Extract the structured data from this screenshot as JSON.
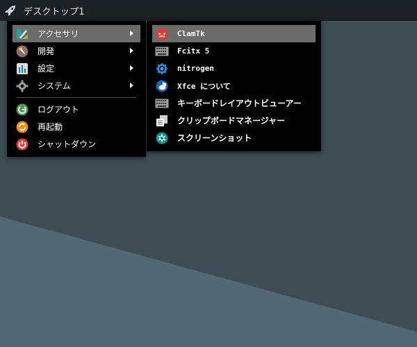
{
  "panel": {
    "title": "デスクトップ1",
    "launcher_icon": "rocket-icon"
  },
  "main_menu": {
    "items": [
      {
        "label": "アクセサリ",
        "icon": "accessories-icon",
        "submenu": true,
        "active": true
      },
      {
        "label": "開発",
        "icon": "development-icon",
        "submenu": true
      },
      {
        "label": "設定",
        "icon": "settings-icon",
        "submenu": true
      },
      {
        "label": "システム",
        "icon": "system-gear-icon",
        "submenu": true
      }
    ],
    "session_items": [
      {
        "label": "ログアウト",
        "icon": "logout-icon"
      },
      {
        "label": "再起動",
        "icon": "restart-icon"
      },
      {
        "label": "シャットダウン",
        "icon": "shutdown-icon"
      }
    ]
  },
  "accessories_menu": {
    "items": [
      {
        "label": "ClamTk",
        "icon": "clamtk-icon",
        "active": true
      },
      {
        "label": "Fcitx 5",
        "icon": "keyboard-icon"
      },
      {
        "label": "nitrogen",
        "icon": "nitrogen-icon"
      },
      {
        "label": "Xfce について",
        "icon": "xfce-mouse-icon"
      },
      {
        "label": "キーボードレイアウトビューアー",
        "icon": "keyboard-layout-icon"
      },
      {
        "label": "クリップボードマネージャー",
        "icon": "clipboard-icon"
      },
      {
        "label": "スクリーンショット",
        "icon": "screenshot-icon"
      }
    ]
  },
  "colors": {
    "panel_bg": "#1c2125",
    "menu_bg": "#000000",
    "active_item_bg": "#6b6b6b",
    "desktop_bg": "#3f4c54",
    "desktop_band": "#506570"
  }
}
